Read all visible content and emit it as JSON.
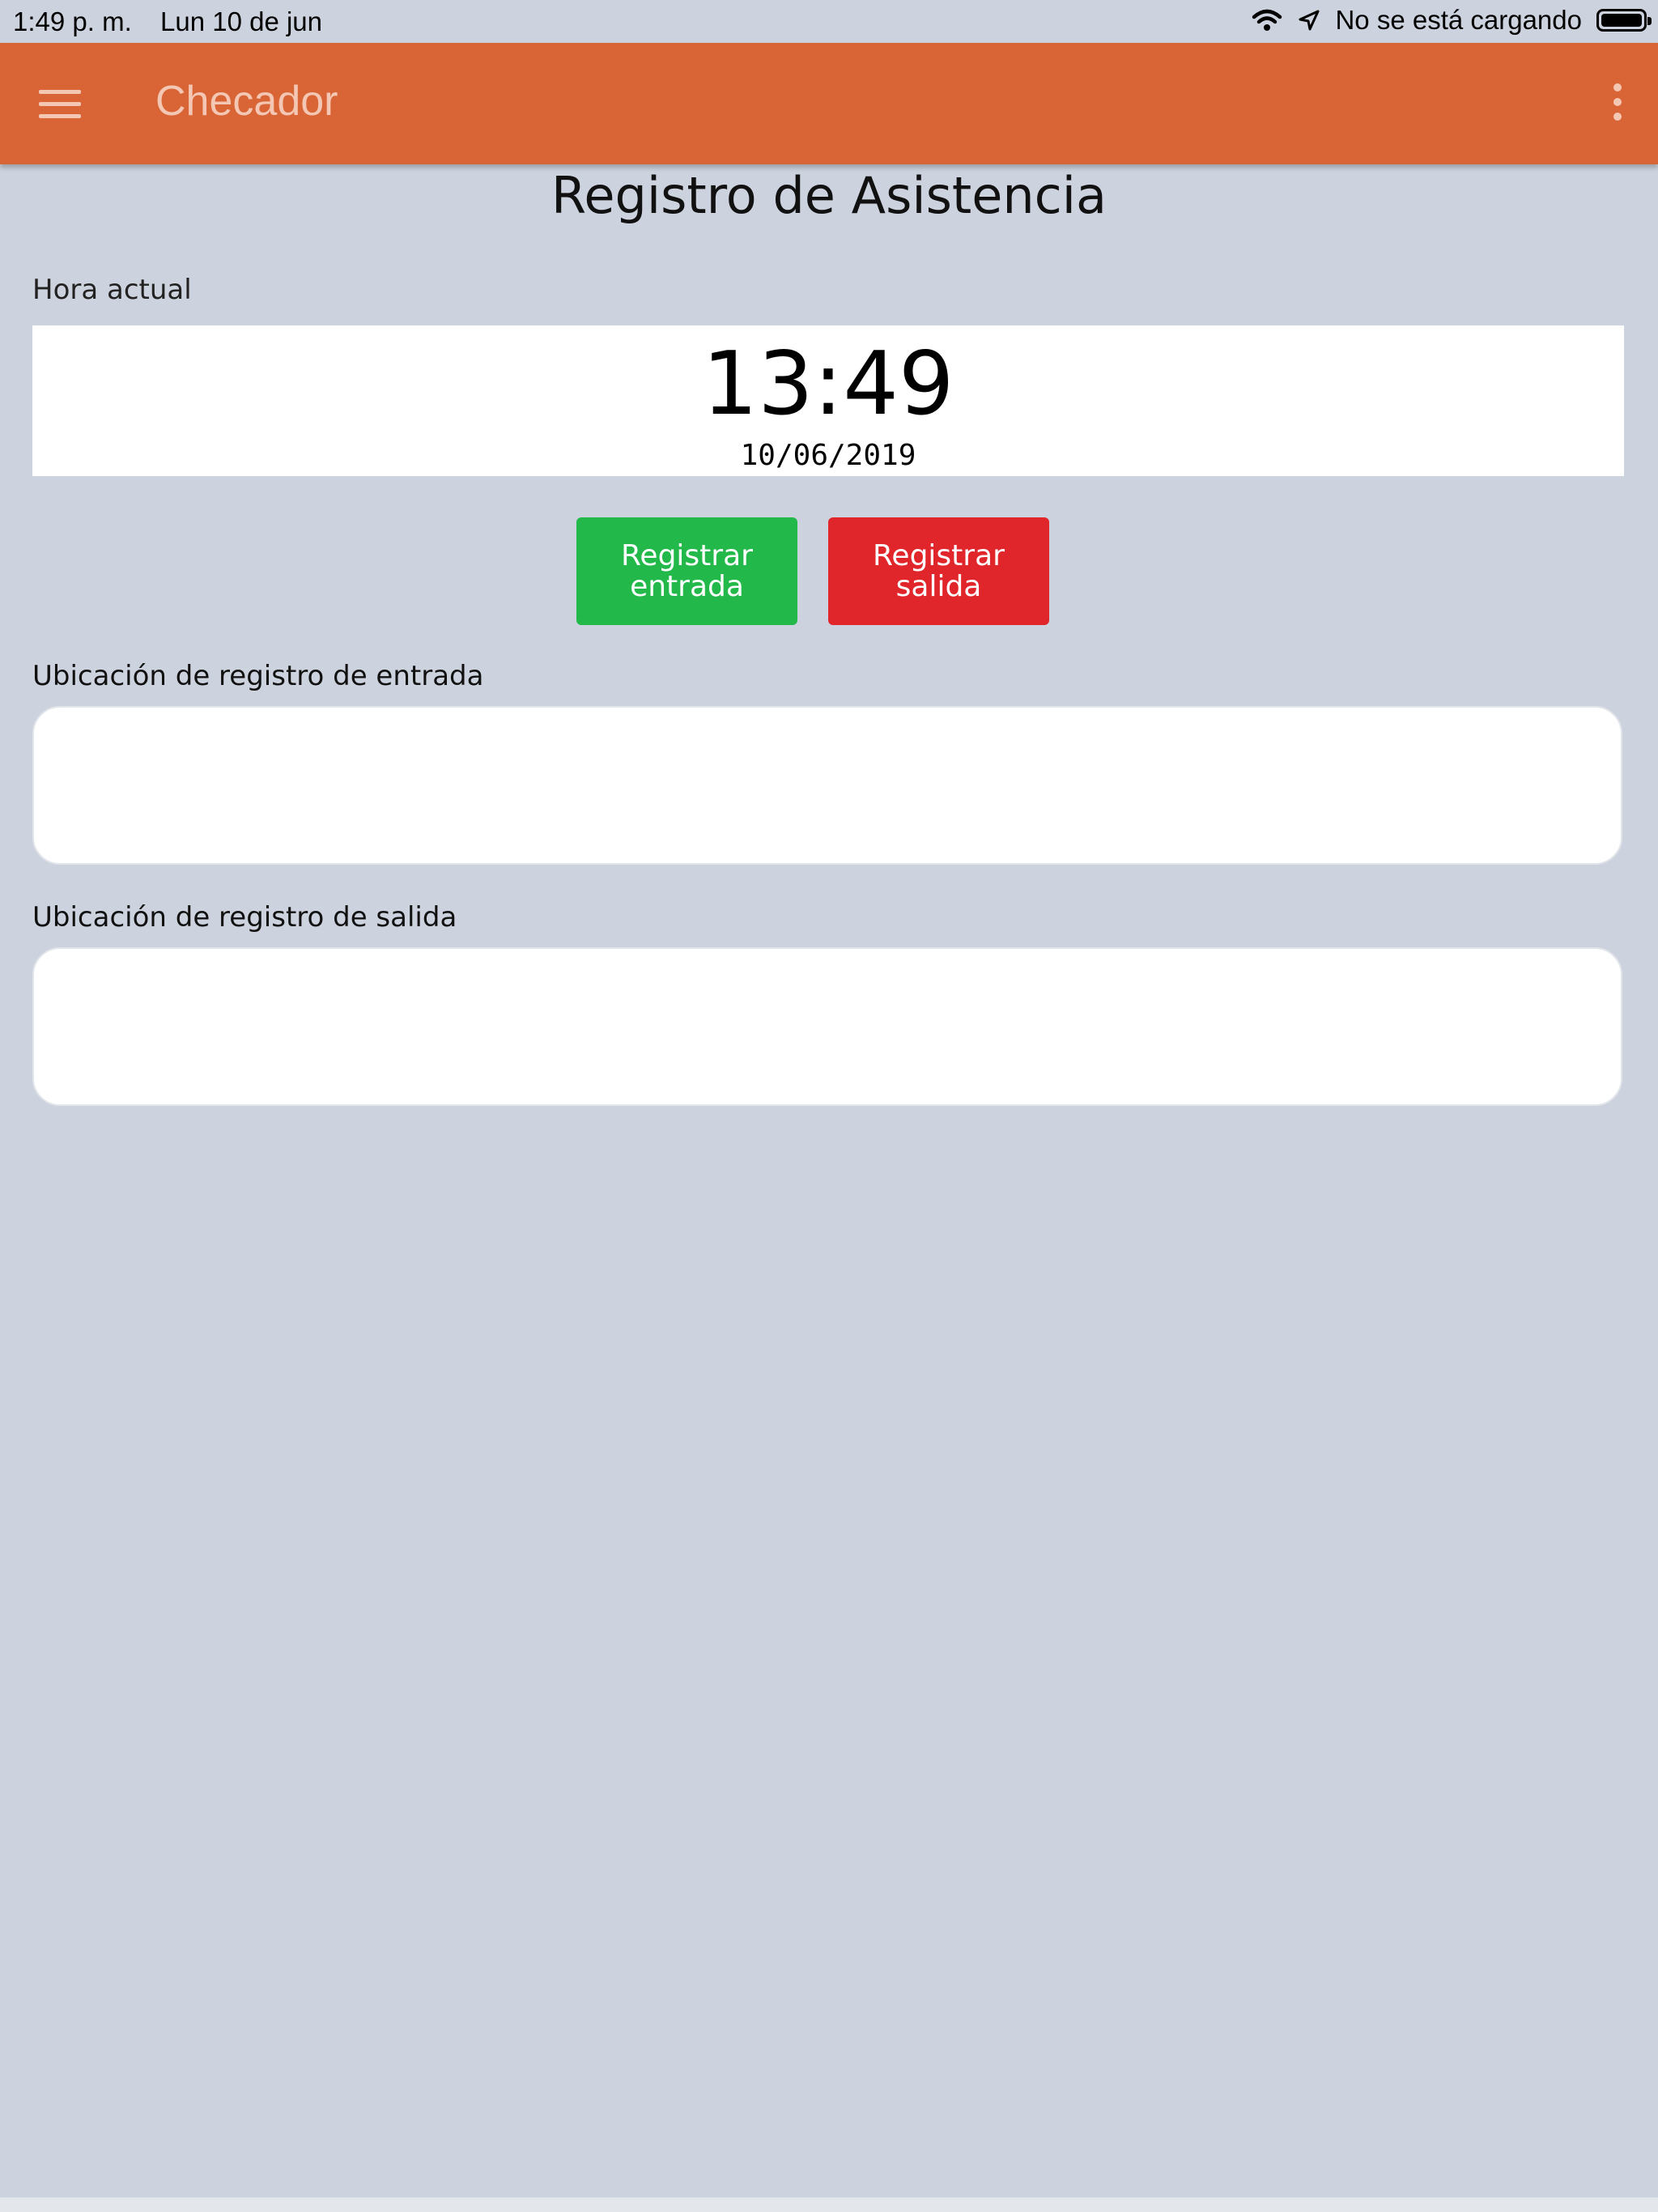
{
  "status_bar": {
    "time": "1:49 p. m.",
    "date": "Lun 10 de jun",
    "charging_text": "No se está cargando",
    "icons": [
      "wifi-icon",
      "location-arrow-icon",
      "battery-icon"
    ]
  },
  "toolbar": {
    "title": "Checador",
    "menu_icon": "hamburger-menu-icon",
    "more_icon": "more-vertical-icon",
    "color": "#d96536"
  },
  "main": {
    "page_title": "Registro de Asistencia",
    "current_time_label": "Hora actual",
    "clock_time": "13:49",
    "clock_date": "10/06/2019",
    "buttons": {
      "check_in_label": "Registrar entrada",
      "check_in_color": "#22b94a",
      "check_out_label": "Registrar salida",
      "check_out_color": "#e0262b"
    },
    "check_in_location_label": "Ubicación de registro de entrada",
    "check_in_location_value": "",
    "check_out_location_label": "Ubicación de registro de salida",
    "check_out_location_value": ""
  }
}
